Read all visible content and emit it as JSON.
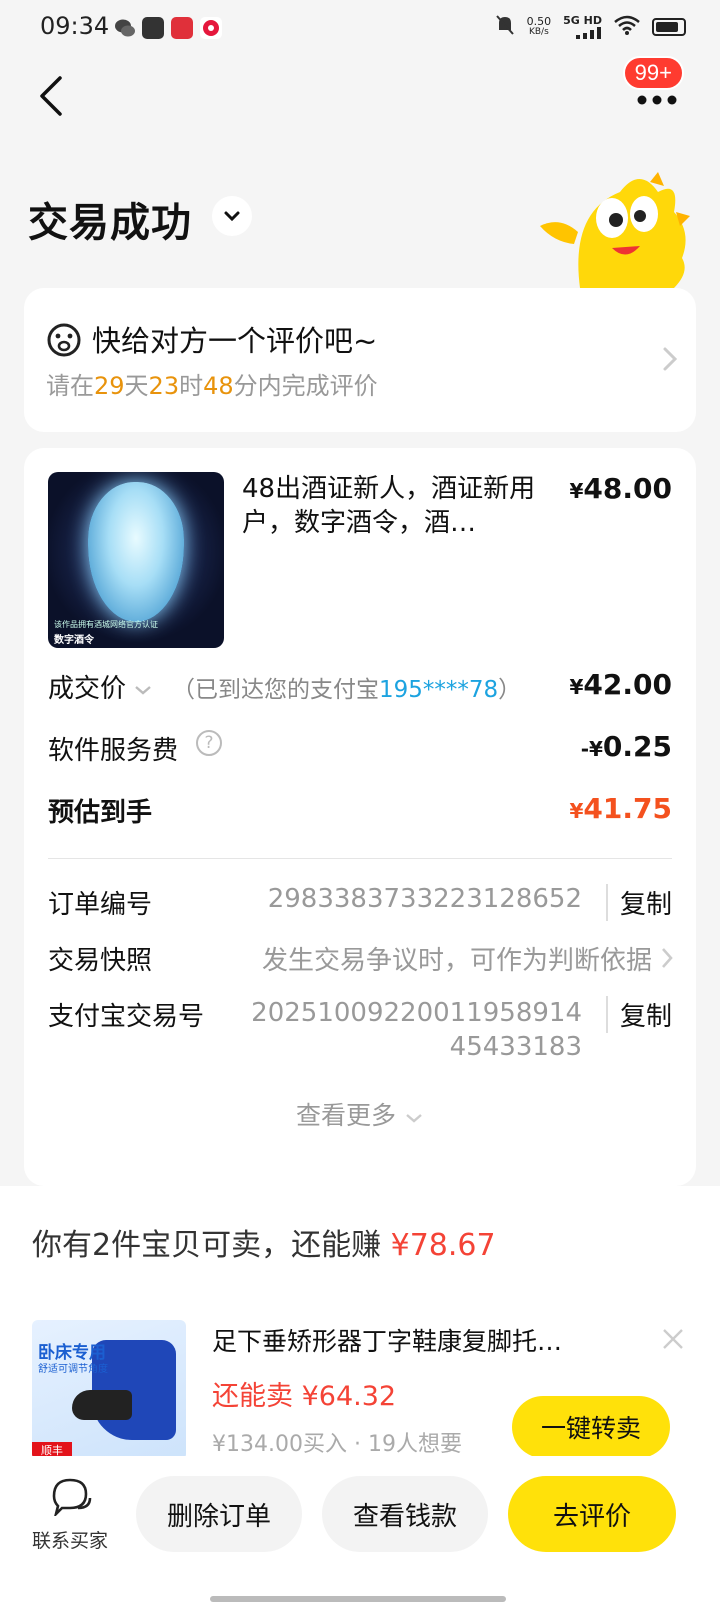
{
  "status_bar": {
    "time": "09:34",
    "net_speed": "0.50",
    "net_unit": "KB/s",
    "network": "5G HD"
  },
  "header": {
    "badge": "99+",
    "title": "交易成功"
  },
  "review": {
    "title": "快给对方一个评价吧~",
    "prefix": "请在",
    "days": "29",
    "days_unit": "天",
    "hours": "23",
    "hours_unit": "时",
    "minutes": "48",
    "suffix": "分内完成评价"
  },
  "product": {
    "title": "48出酒证新人，酒证新用户，数字酒令，酒…",
    "price_symbol": "¥",
    "price": "48.00",
    "thumb_caption": "该作品拥有酒城网络官方认证",
    "thumb_label": "数字酒令"
  },
  "price_rows": {
    "deal_label": "成交价",
    "deal_hint_prefix": "（已到达您的支付宝",
    "deal_hint_account": "195****78",
    "deal_hint_suffix": "）",
    "deal_value": "42.00",
    "fee_label": "软件服务费",
    "fee_prefix": "-¥",
    "fee_value": "0.25",
    "est_label": "预估到手",
    "est_value": "41.75"
  },
  "info_rows": {
    "order_no_label": "订单编号",
    "order_no": "2983383733223128652",
    "copy_label": "复制",
    "snapshot_label": "交易快照",
    "snapshot_value": "发生交易争议时，可作为判断依据",
    "alipay_label": "支付宝交易号",
    "alipay_no_line1": "20251009220011958914",
    "alipay_no_line2": "45433183",
    "see_more": "查看更多"
  },
  "recommend": {
    "title_prefix": "你有2件宝贝可卖，还能赚 ",
    "title_amount": "¥78.67",
    "item_name": "足下垂矫形器丁字鞋康复脚托…",
    "sell_label": "还能卖 ¥64.32",
    "meta": "¥134.00买入 · 19人想要",
    "resell_button": "一键转卖",
    "img_title": "卧床专用",
    "img_sub": "舒适可调节角度",
    "img_tag": "顺丰"
  },
  "bottom_bar": {
    "contact": "联系买家",
    "delete": "删除订单",
    "view_money": "查看钱款",
    "review": "去评价"
  },
  "colors": {
    "accent_yellow": "#ffe10a",
    "orange_countdown": "#e8930c",
    "red_price": "#f44336",
    "link_blue": "#1ca3e0"
  }
}
